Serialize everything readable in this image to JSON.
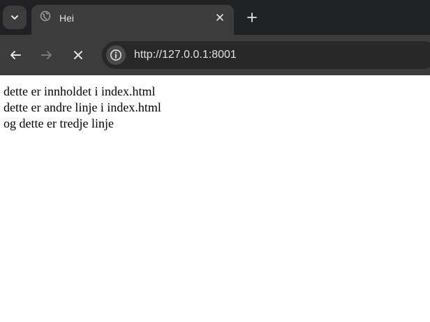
{
  "tab": {
    "title": "Hei",
    "favicon_icon": "globe-icon"
  },
  "toolbar": {
    "url": "http://127.0.0.1:8001"
  },
  "page": {
    "lines": [
      "dette er innholdet i index.html",
      "dette er andre linje i index.html",
      "og dette er tredje linje"
    ]
  },
  "colors": {
    "tabstrip_bg": "#202124",
    "toolbar_bg": "#3c3c3c",
    "omnibox_bg": "#282828",
    "page_bg": "#ffffff"
  }
}
